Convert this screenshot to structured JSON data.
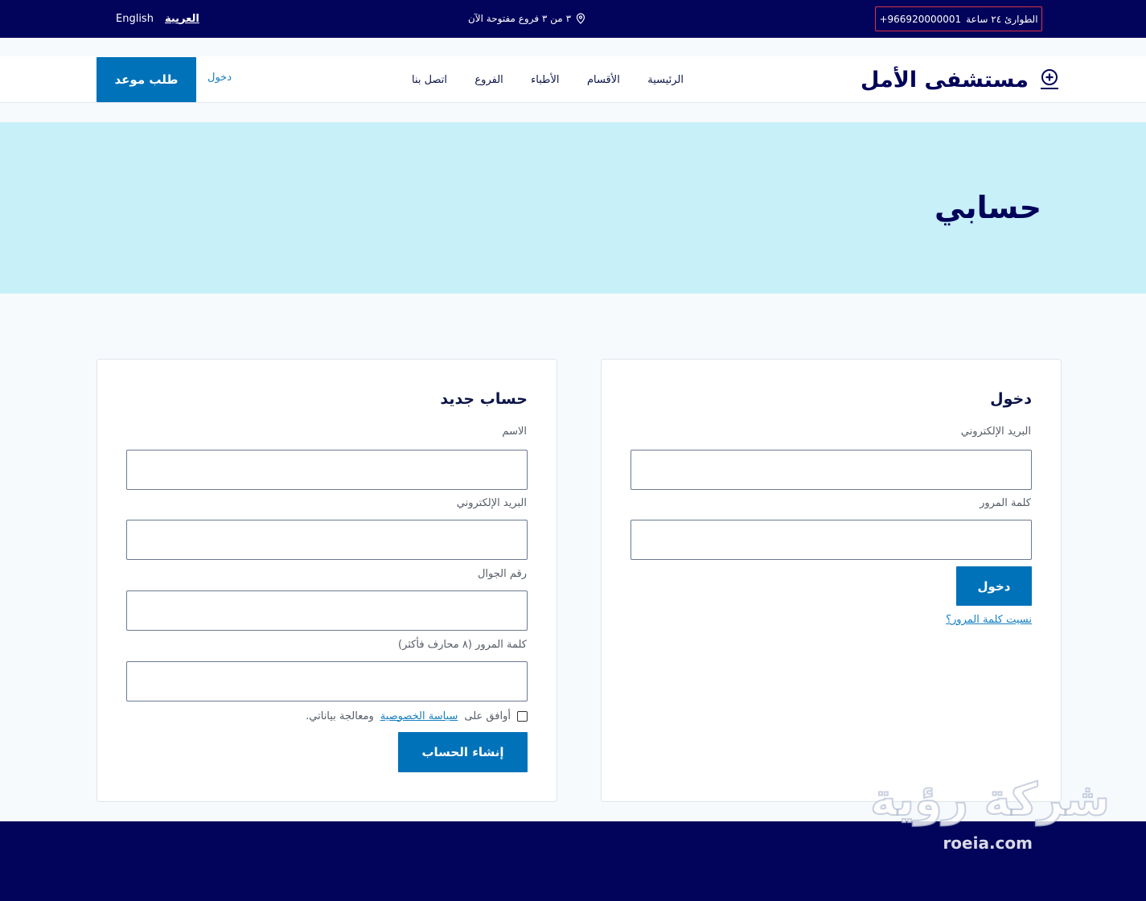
{
  "topbar": {
    "emergency_label": "الطوارئ ٢٤ ساعة",
    "emergency_phone": "+966920000001",
    "branches_text": "٣ من ٣ فروع مفتوحة الآن",
    "lang_arabic": "العربية",
    "lang_english": "English"
  },
  "header": {
    "brand_name": "مستشفى الأمل",
    "nav": [
      "الرئيسية",
      "الأقسام",
      "الأطباء",
      "الفروع",
      "اتصل بنا"
    ],
    "login_link": "دخول",
    "appointment_button": "طلب موعد"
  },
  "hero": {
    "title": "حسابي"
  },
  "login": {
    "title": "دخول",
    "email_label": "البريد الإلكتروني",
    "password_label": "كلمة المرور",
    "submit": "دخول",
    "forgot": "نسيت كلمة المرور؟"
  },
  "register": {
    "title": "حساب جديد",
    "name_label": "الاسم",
    "email_label": "البريد الإلكتروني",
    "phone_label": "رقم الجوال",
    "password_label": "كلمة المرور (٨ محارف فأكثر)",
    "consent_prefix": "أوافق على",
    "consent_link": "سياسة الخصوصية",
    "consent_suffix": "ومعالجة بياناتي.",
    "submit": "إنشاء الحساب"
  },
  "watermark": {
    "arabic": "شركة رؤية",
    "english": "roeia.com"
  },
  "colors": {
    "navy": "#02035a",
    "primary": "#0072b9",
    "hero_bg": "#c8f0f8",
    "link": "#1780c2",
    "emergency_border": "#d9334a"
  }
}
